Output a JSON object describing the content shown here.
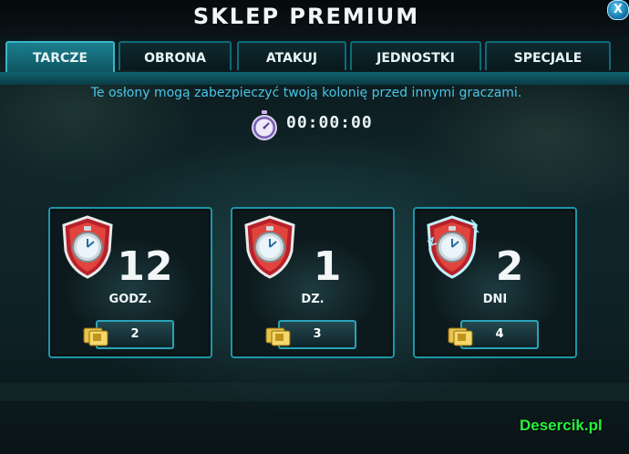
{
  "window": {
    "title": "SKLEP PREMIUM",
    "close_label": "X"
  },
  "tabs": [
    {
      "label": "TARCZE",
      "active": true
    },
    {
      "label": "OBRONA",
      "active": false
    },
    {
      "label": "ATAKUJ",
      "active": false
    },
    {
      "label": "JEDNOSTKI",
      "active": false
    },
    {
      "label": "SPECJALE",
      "active": false
    }
  ],
  "description": "Te osłony mogą zabezpieczyć twoją kolonię przed innymi graczami.",
  "timer": {
    "icon": "stopwatch-icon",
    "value": "00:00:00"
  },
  "items": [
    {
      "amount": "12",
      "unit": "GODZ.",
      "price": "2",
      "icon": "shield-clock-icon",
      "price_icon": "coin-card-icon"
    },
    {
      "amount": "1",
      "unit": "DZ.",
      "price": "3",
      "icon": "shield-clock-icon",
      "price_icon": "coin-card-icon"
    },
    {
      "amount": "2",
      "unit": "DNI",
      "price": "4",
      "icon": "shield-clock-icon",
      "price_icon": "coin-card-icon"
    }
  ],
  "watermark": "Desercik.pl",
  "colors": {
    "accent": "#1e95a8",
    "text_cyan": "#48c6e6",
    "watermark": "#26f23a"
  }
}
